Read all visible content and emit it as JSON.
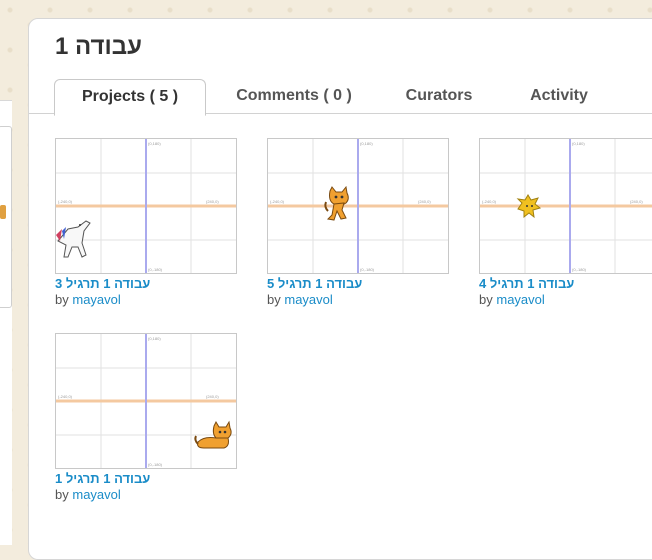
{
  "page": {
    "title": "עבודה 1"
  },
  "tabs": [
    {
      "label": "Projects ( 5 )",
      "active": true
    },
    {
      "label": "Comments ( 0 )",
      "active": false
    },
    {
      "label": "Curators",
      "active": false
    },
    {
      "label": "Activity",
      "active": false
    }
  ],
  "projects": [
    {
      "title": "עבודה 1 תרגיל 3",
      "by_label": "by",
      "author": "mayavol",
      "sprite": "unicorn-icon"
    },
    {
      "title": "עבודה 1 תרגיל 5",
      "by_label": "by",
      "author": "mayavol",
      "sprite": "scratch-cat-icon"
    },
    {
      "title": "עבודה 1 תרגיל 4",
      "by_label": "by",
      "author": "mayavol",
      "sprite": "yellow-creature-icon"
    },
    {
      "title": "עבודה 1 תרגיל 1",
      "by_label": "by",
      "author": "mayavol",
      "sprite": "scratch-cat-sitting-icon"
    }
  ],
  "colors": {
    "link": "#1a8cc8",
    "axis": "#9999ee",
    "grid": "#dddddd",
    "cat": "#f0a030"
  }
}
